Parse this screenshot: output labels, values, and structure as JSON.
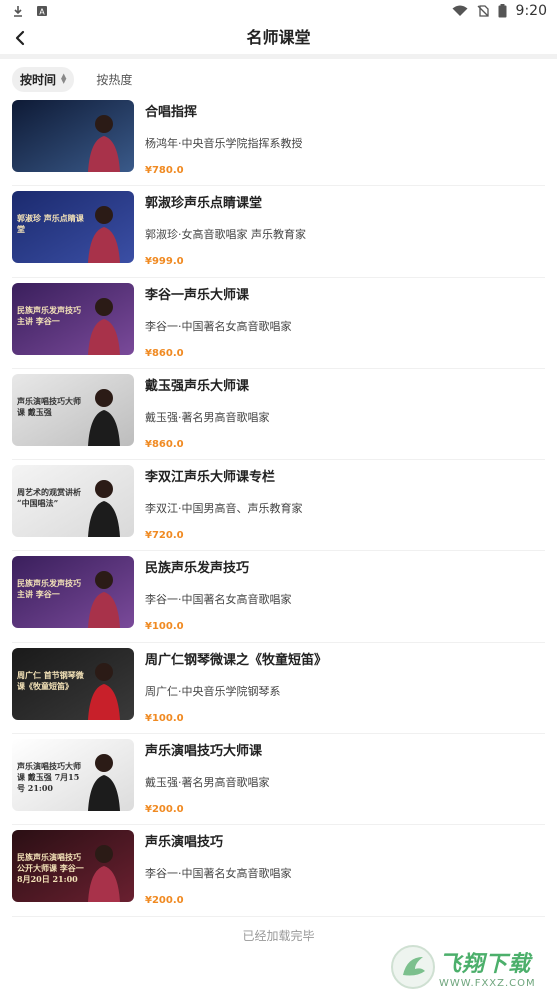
{
  "status_bar": {
    "time": "9:20"
  },
  "header": {
    "title": "名师课堂"
  },
  "sort": {
    "by_time": "按时间",
    "by_popularity": "按热度"
  },
  "courses": [
    {
      "title": "合唱指挥",
      "subtitle": "杨鸿年·中央音乐学院指挥系教授",
      "price": "¥780.0",
      "thumb_text": "",
      "thumb_colors": [
        "#0e1a35",
        "#3a5a8a"
      ]
    },
    {
      "title": "郭淑珍声乐点睛课堂",
      "subtitle": "郭淑珍·女高音歌唱家 声乐教育家",
      "price": "¥999.0",
      "thumb_text": "郭淑珍 声乐点睛课堂",
      "thumb_colors": [
        "#1b2a6e",
        "#3b4fa5"
      ]
    },
    {
      "title": "李谷一声乐大师课",
      "subtitle": "李谷一·中国著名女高音歌唱家",
      "price": "¥860.0",
      "thumb_text": "民族声乐发声技巧 主讲 李谷一",
      "thumb_colors": [
        "#3a1f5c",
        "#7a4a9a"
      ]
    },
    {
      "title": "戴玉强声乐大师课",
      "subtitle": "戴玉强·著名男高音歌唱家",
      "price": "¥860.0",
      "thumb_text": "声乐演唱技巧大师课 戴玉强",
      "thumb_colors": [
        "#e8e8e8",
        "#bdbdbd"
      ]
    },
    {
      "title": "李双江声乐大师课专栏",
      "subtitle": "李双江·中国男高音、声乐教育家",
      "price": "¥720.0",
      "thumb_text": "周艺术的观赏讲析 “中国唱法”",
      "thumb_colors": [
        "#f4f4f4",
        "#d9d9d9"
      ]
    },
    {
      "title": "民族声乐发声技巧",
      "subtitle": "李谷一·中国著名女高音歌唱家",
      "price": "¥100.0",
      "thumb_text": "民族声乐发声技巧 主讲 李谷一",
      "thumb_colors": [
        "#3a1f5c",
        "#7a4a9a"
      ]
    },
    {
      "title": "周广仁钢琴微课之《牧童短笛》",
      "subtitle": "周广仁·中央音乐学院钢琴系",
      "price": "¥100.0",
      "thumb_text": "周广仁 首节钢琴微课《牧童短笛》",
      "thumb_colors": [
        "#1a1a1a",
        "#3a3a3a"
      ]
    },
    {
      "title": "声乐演唱技巧大师课",
      "subtitle": "戴玉强·著名男高音歌唱家",
      "price": "¥200.0",
      "thumb_text": "声乐演唱技巧大师课 戴玉强 7月15号 21:00",
      "thumb_colors": [
        "#ffffff",
        "#dcdcdc"
      ]
    },
    {
      "title": "声乐演唱技巧",
      "subtitle": "李谷一·中国著名女高音歌唱家",
      "price": "¥200.0",
      "thumb_text": "民族声乐演唱技巧公开大师课 李谷一 8月20日 21:00",
      "thumb_colors": [
        "#2a0f14",
        "#6a2030"
      ]
    }
  ],
  "footer": {
    "end_text": "已经加载完毕"
  },
  "watermark": {
    "cn": "飞翔下载",
    "en": "WWW.FXXZ.COM"
  },
  "colors": {
    "price": "#f08a22",
    "accent": "#4caf6b"
  }
}
